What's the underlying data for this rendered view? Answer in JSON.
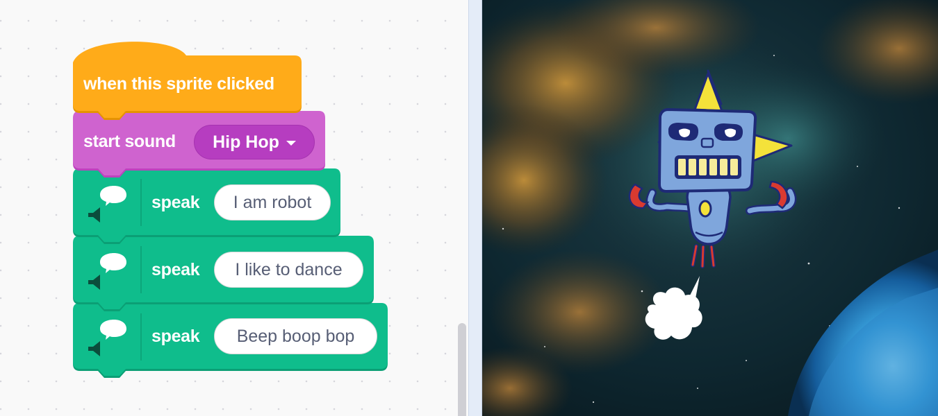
{
  "workspace": {
    "hat_block": {
      "label": "when this sprite clicked",
      "color": "#ffab19"
    },
    "sound_block": {
      "label": "start sound",
      "sound_selected": "Hip Hop",
      "color": "#cf63cf"
    },
    "speak_blocks": [
      {
        "label": "speak",
        "text": "I am robot",
        "icon": "speech-speaker-icon"
      },
      {
        "label": "speak",
        "text": "I like to dance",
        "icon": "speech-speaker-icon"
      },
      {
        "label": "speak",
        "text": "Beep boop bop",
        "icon": "speech-speaker-icon"
      }
    ],
    "extension_color": "#0fbd8c"
  },
  "stage": {
    "backdrop": "nebula-space",
    "sprites": [
      "robot-sprite",
      "smoke-puff"
    ]
  }
}
